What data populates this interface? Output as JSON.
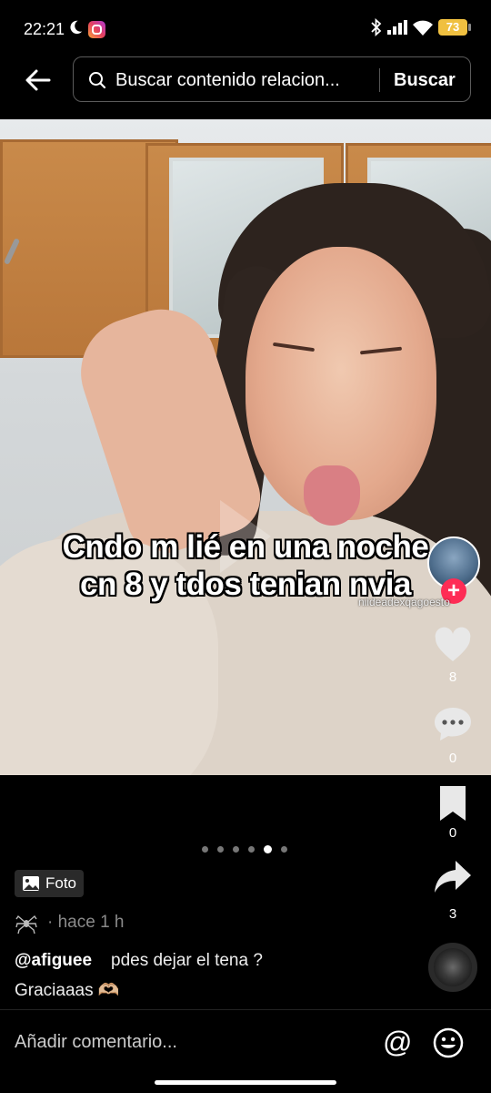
{
  "status_bar": {
    "time": "22:21",
    "battery": "73"
  },
  "search": {
    "placeholder": "Buscar contenido relacion...",
    "submit_label": "Buscar"
  },
  "post": {
    "caption_line1": "Cndo m lié en una noche",
    "caption_line2": "cn 8 y tdos tenian nvia",
    "watermark": "niideadexqagoesto",
    "photo_indicator": {
      "count": 6,
      "active_index": 4
    },
    "type_badge": "Foto",
    "time_ago": "· hace 1 h",
    "author": "@afiguee",
    "description": "pdes dejar el tena ?",
    "description_line2": "Graciaaas 🫶🏼"
  },
  "actions": {
    "likes": "8",
    "comments": "0",
    "bookmarks": "0",
    "shares": "3"
  },
  "comment_bar": {
    "placeholder": "Añadir comentario..."
  },
  "colors": {
    "follow_accent": "#fe2c55",
    "battery": "#f0c040",
    "background": "#000000"
  },
  "icons": [
    "back-arrow-icon",
    "search-icon",
    "heart-icon",
    "comment-icon",
    "bookmark-icon",
    "share-icon",
    "image-icon",
    "at-icon",
    "emoji-icon",
    "moon-icon",
    "instagram-icon",
    "bluetooth-icon",
    "signal-icon",
    "wifi-icon"
  ]
}
